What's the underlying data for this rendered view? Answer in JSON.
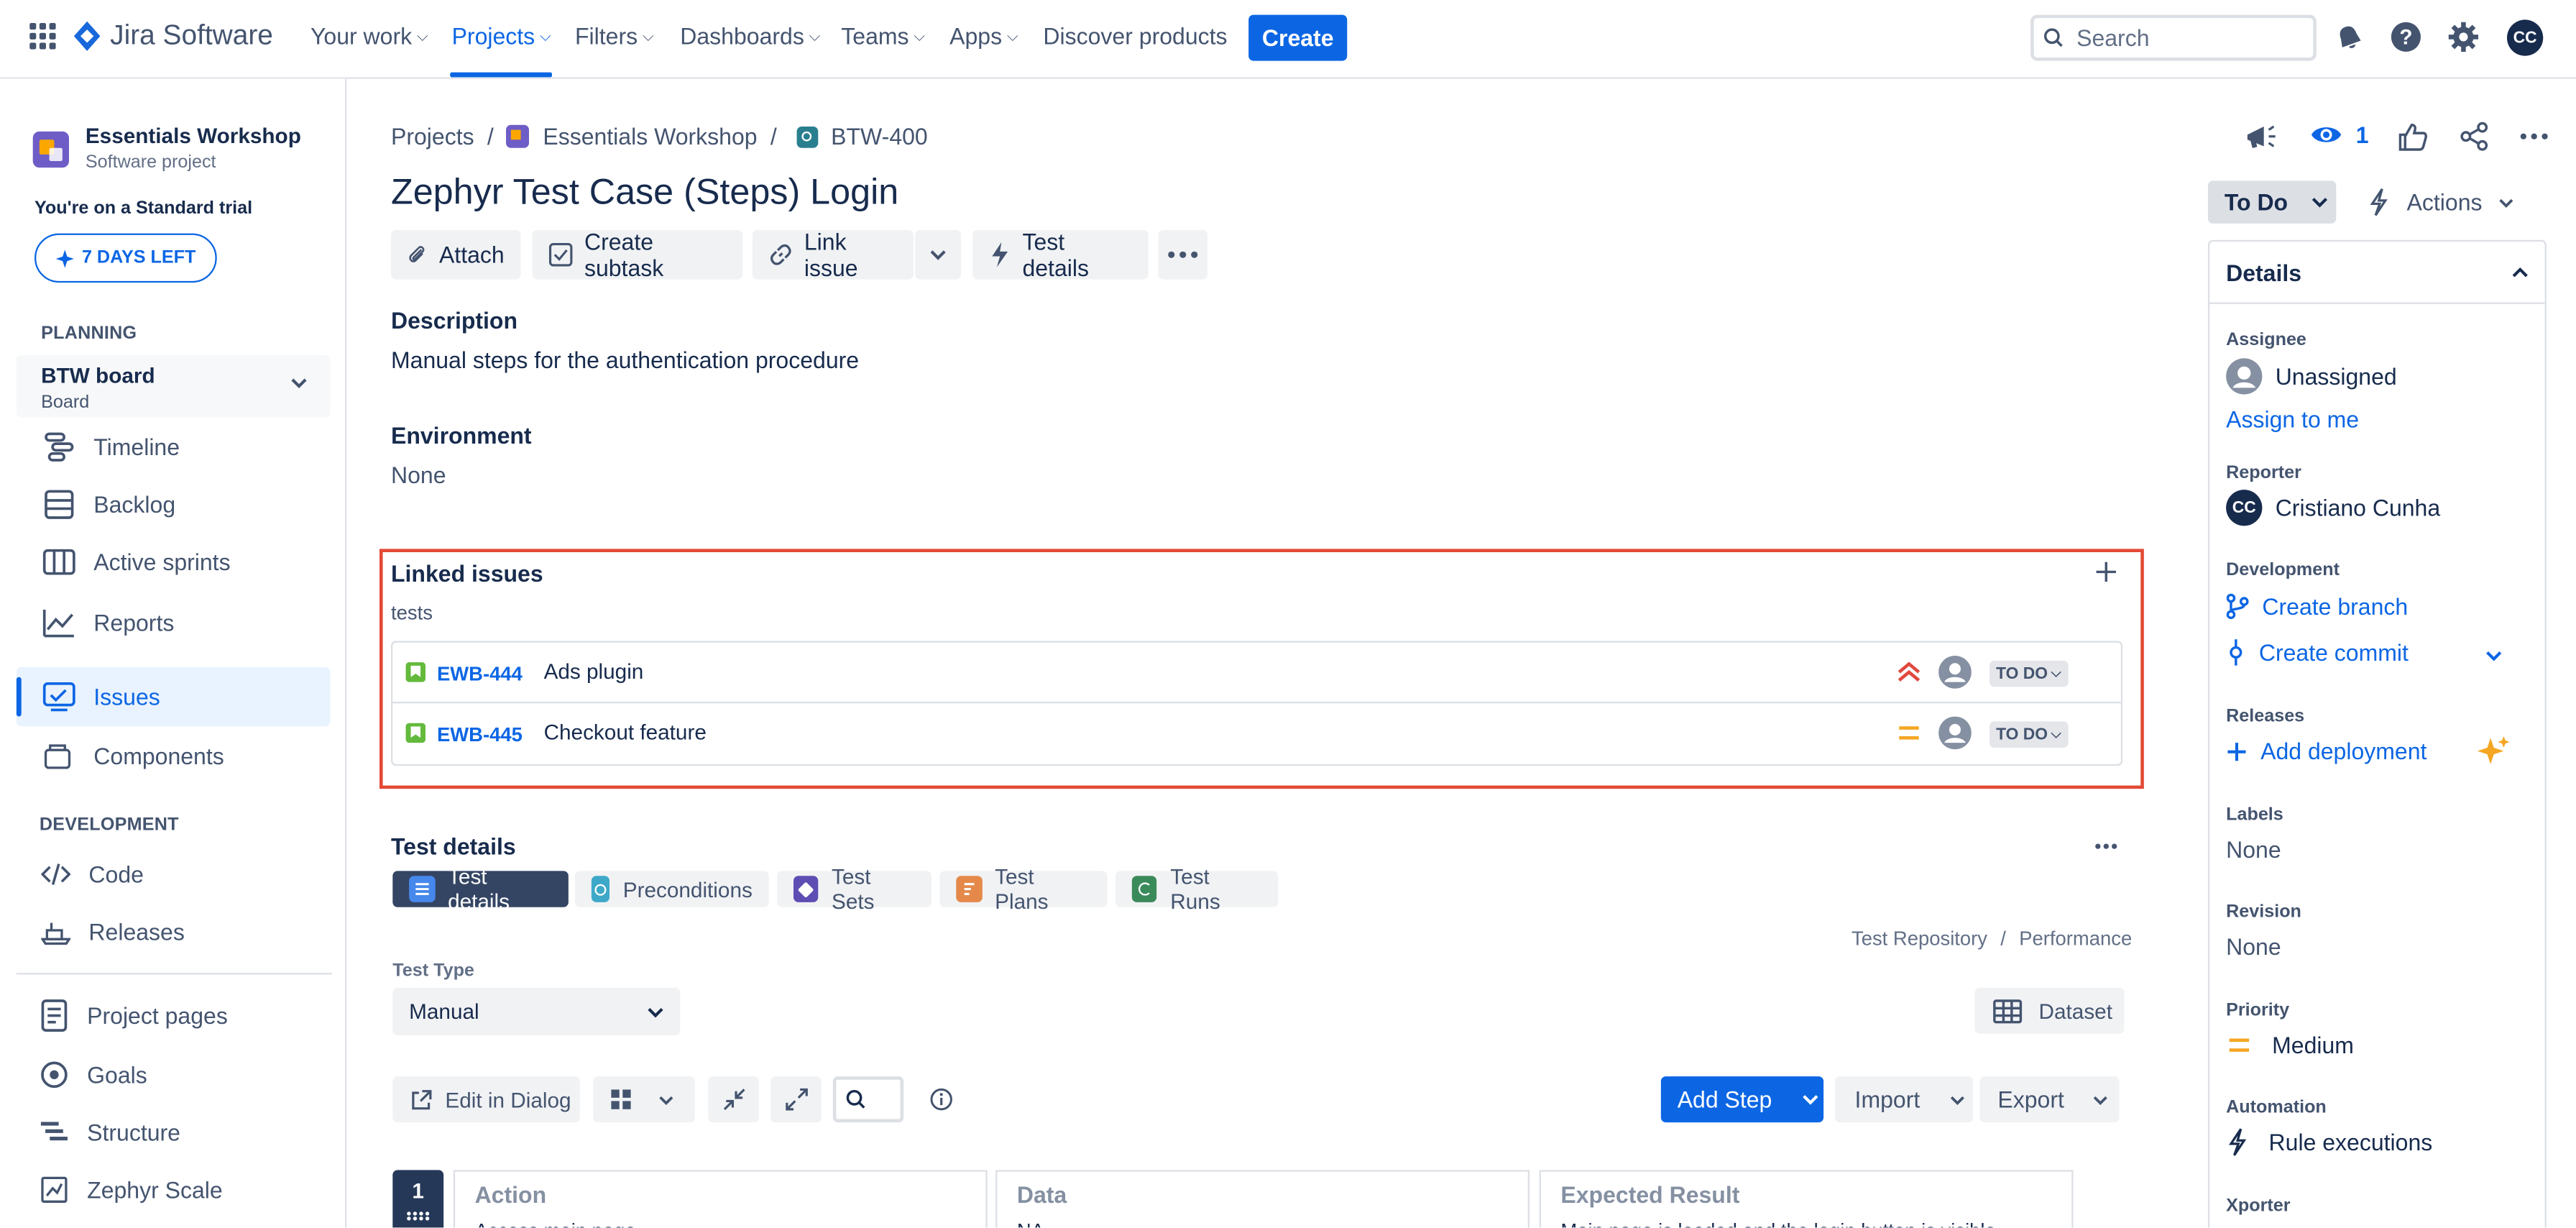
{
  "app": {
    "name": "Jira Software"
  },
  "nav": {
    "items": [
      {
        "label": "Your work"
      },
      {
        "label": "Projects"
      },
      {
        "label": "Filters"
      },
      {
        "label": "Dashboards"
      },
      {
        "label": "Teams"
      },
      {
        "label": "Apps"
      },
      {
        "label": "Discover products"
      }
    ],
    "create_label": "Create",
    "search_placeholder": "Search",
    "avatar_initials": "CC"
  },
  "sidebar": {
    "project_name": "Essentials Workshop",
    "project_type": "Software project",
    "trial_text": "You're on a Standard trial",
    "trial_button": "7 DAYS LEFT",
    "planning_heading": "PLANNING",
    "board_name": "BTW board",
    "board_type": "Board",
    "planning_items": [
      {
        "label": "Timeline",
        "icon": "timeline-icon"
      },
      {
        "label": "Backlog",
        "icon": "backlog-icon"
      },
      {
        "label": "Active sprints",
        "icon": "sprints-icon"
      },
      {
        "label": "Reports",
        "icon": "reports-icon"
      },
      {
        "label": "Issues",
        "icon": "issues-icon"
      },
      {
        "label": "Components",
        "icon": "components-icon"
      }
    ],
    "development_heading": "DEVELOPMENT",
    "development_items": [
      {
        "label": "Code",
        "icon": "code-icon"
      },
      {
        "label": "Releases",
        "icon": "releases-icon"
      }
    ],
    "other_items": [
      {
        "label": "Project pages",
        "icon": "pages-icon"
      },
      {
        "label": "Goals",
        "icon": "goals-icon"
      },
      {
        "label": "Structure",
        "icon": "structure-icon"
      },
      {
        "label": "Zephyr Scale",
        "icon": "zephyr-icon"
      }
    ]
  },
  "breadcrumb": {
    "root": "Projects",
    "project": "Essentials Workshop",
    "issue": "BTW-400",
    "separator": "/"
  },
  "issue": {
    "title": "Zephyr Test Case (Steps) Login",
    "toolbar": {
      "attach": "Attach",
      "create_subtask": "Create subtask",
      "link_issue": "Link issue",
      "test_details": "Test details"
    },
    "description_label": "Description",
    "description": "Manual steps for the authentication procedure",
    "environment_label": "Environment",
    "environment": "None"
  },
  "linked_issues": {
    "heading": "Linked issues",
    "relation": "tests",
    "items": [
      {
        "key": "EWB-444",
        "summary": "Ads plugin",
        "priority": "high",
        "status": "TO DO"
      },
      {
        "key": "EWB-445",
        "summary": "Checkout feature",
        "priority": "medium",
        "status": "TO DO"
      }
    ]
  },
  "test_details": {
    "heading": "Test details",
    "tabs": [
      {
        "label": "Test details",
        "active": true
      },
      {
        "label": "Preconditions"
      },
      {
        "label": "Test Sets"
      },
      {
        "label": "Test Plans"
      },
      {
        "label": "Test Runs"
      }
    ],
    "links": {
      "repository": "Test Repository",
      "separator": "/",
      "performance": "Performance"
    },
    "test_type_label": "Test Type",
    "test_type": "Manual",
    "dataset": "Dataset",
    "edit_dialog": "Edit in Dialog",
    "add_step": "Add Step",
    "import": "Import",
    "export": "Export",
    "step_number": "1",
    "columns": [
      "Action",
      "Data",
      "Expected Result"
    ],
    "first_row": [
      "Access main page",
      "NA",
      "Main page is loaded and the login button is visible"
    ]
  },
  "right_panel": {
    "watch_count": "1",
    "status": "To Do",
    "actions": "Actions",
    "details_heading": "Details",
    "assignee_label": "Assignee",
    "assignee": "Unassigned",
    "assign_to_me": "Assign to me",
    "reporter_label": "Reporter",
    "reporter": "Cristiano Cunha",
    "reporter_initials": "CC",
    "development_label": "Development",
    "create_branch": "Create branch",
    "create_commit": "Create commit",
    "releases_label": "Releases",
    "add_deployment": "Add deployment",
    "labels_label": "Labels",
    "labels": "None",
    "revision_label": "Revision",
    "revision": "None",
    "priority_label": "Priority",
    "priority": "Medium",
    "automation_label": "Automation",
    "automation": "Rule executions",
    "xporter_label": "Xporter"
  },
  "colors": {
    "accent": "#0c66e4",
    "highlight_border": "#e34935",
    "priority_high": "#e2483d",
    "priority_medium": "#f5a623"
  }
}
